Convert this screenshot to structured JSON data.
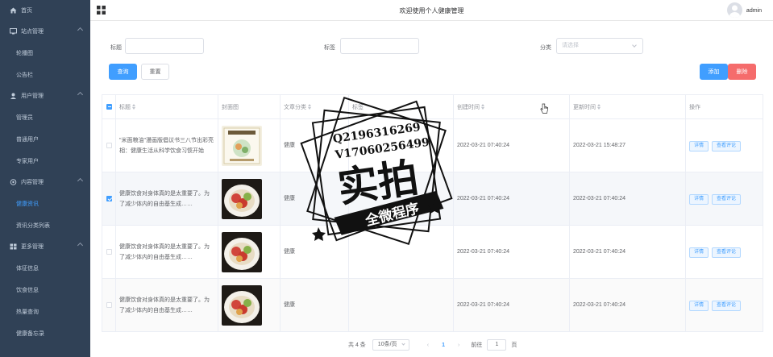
{
  "sidebar": {
    "items": [
      {
        "label": "首页",
        "type": "top",
        "icon": "home-icon"
      },
      {
        "label": "站点管理",
        "type": "top",
        "icon": "monitor-icon",
        "expandable": true
      },
      {
        "label": "轮播图",
        "type": "sub"
      },
      {
        "label": "公告栏",
        "type": "sub"
      },
      {
        "label": "用户管理",
        "type": "top",
        "icon": "user-icon",
        "expandable": true
      },
      {
        "label": "管理员",
        "type": "sub"
      },
      {
        "label": "普通用户",
        "type": "sub"
      },
      {
        "label": "专家用户",
        "type": "sub"
      },
      {
        "label": "内容管理",
        "type": "top",
        "icon": "content-icon",
        "expandable": true
      },
      {
        "label": "健康资讯",
        "type": "sub",
        "active": true
      },
      {
        "label": "资讯分类列表",
        "type": "sub"
      },
      {
        "label": "更多管理",
        "type": "top",
        "icon": "more-icon",
        "expandable": true
      },
      {
        "label": "体征信息",
        "type": "sub"
      },
      {
        "label": "饮食信息",
        "type": "sub"
      },
      {
        "label": "热量查询",
        "type": "sub"
      },
      {
        "label": "健康备忘录",
        "type": "sub"
      }
    ]
  },
  "header": {
    "title": "欢迎使用个人健康管理",
    "username": "admin"
  },
  "filters": {
    "title_label": "标题",
    "tag_label": "标签",
    "category_label": "分类",
    "category_placeholder": "请选择",
    "query_btn": "查询",
    "reset_btn": "重置",
    "add_btn": "添加",
    "delete_btn": "删除"
  },
  "table": {
    "headers": [
      "标题",
      "封面图",
      "文章分类",
      "标签",
      "创建时间",
      "更新时间",
      "操作"
    ],
    "rows": [
      {
        "title": "\"米面粮油\"漫画版倡议书三八节出彩亮相：健康生活从科学饮食习惯开始",
        "category": "健康",
        "tag": "",
        "created": "2022-03-21 07:40:24",
        "updated": "2022-03-21 15:48:27",
        "checked": false
      },
      {
        "title": "健康饮食对身体真的是太重要了。为了减少体内的自由基生成……",
        "category": "健康",
        "tag": "",
        "created": "2022-03-21 07:40:24",
        "updated": "2022-03-21 07:40:24",
        "checked": true
      },
      {
        "title": "健康饮食对身体真的是太重要了。为了减少体内的自由基生成……",
        "category": "健康",
        "tag": "",
        "created": "2022-03-21 07:40:24",
        "updated": "2022-03-21 07:40:24",
        "checked": false
      },
      {
        "title": "健康饮食对身体真的是太重要了。为了减少体内的自由基生成……",
        "category": "健康",
        "tag": "",
        "created": "2022-03-21 07:40:24",
        "updated": "2022-03-21 07:40:24",
        "checked": false
      }
    ],
    "detail_btn": "详情",
    "comment_btn": "查看评论"
  },
  "pager": {
    "total": "共 4 条",
    "page_size": "10条/页",
    "current": "1",
    "goto_label": "前往",
    "goto_value": "1",
    "page_unit": "页"
  },
  "watermark": {
    "line1": "Q2196316269",
    "line2": "V17060256499",
    "main": "实拍",
    "banner": "全微程序"
  }
}
